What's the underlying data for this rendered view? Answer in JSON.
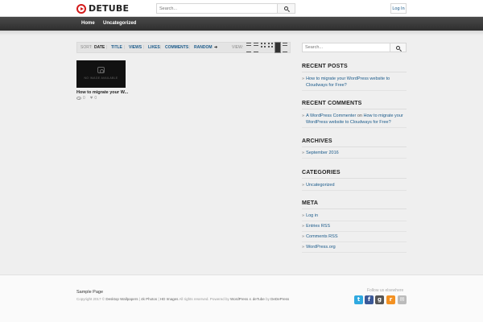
{
  "header": {
    "logo_text": "DETUBE",
    "search_placeholder": "Search...",
    "login_label": "Log In"
  },
  "nav": {
    "items": [
      {
        "label": "Home"
      },
      {
        "label": "Uncategorized"
      }
    ]
  },
  "sortbar": {
    "sort_label": "SORT:",
    "options": [
      "DATE",
      "TITLE",
      "VIEWS",
      "LIKES",
      "COMMENTS",
      "RANDOM"
    ],
    "active": "DATE",
    "random_arrow": "➔",
    "view_label": "VIEW:",
    "separator": "|"
  },
  "posts": [
    {
      "thumb_text": "NO IMAGE AVAILABLE",
      "title": "How to migrate your W...",
      "views": "0",
      "likes": "0"
    }
  ],
  "sidebar": {
    "search_placeholder": "Search...",
    "recent_posts": {
      "title": "RECENT POSTS",
      "items": [
        {
          "line1": "How to migrate your WordPress website to",
          "line2": "Cloudways for Free?"
        }
      ]
    },
    "recent_comments": {
      "title": "RECENT COMMENTS",
      "items": [
        {
          "author": "A WordPress Commenter",
          "on": "on",
          "line1": "How to migrate your",
          "line2": "WordPress website to Cloudways for Free?"
        }
      ]
    },
    "archives": {
      "title": "ARCHIVES",
      "items": [
        {
          "label": "September 2016"
        }
      ]
    },
    "categories": {
      "title": "CATEGORIES",
      "items": [
        {
          "label": "Uncategorized"
        }
      ]
    },
    "meta": {
      "title": "META",
      "items": [
        {
          "label": "Log in"
        },
        {
          "label": "Entries RSS"
        },
        {
          "label": "Comments RSS"
        },
        {
          "label": "WordPress.org"
        }
      ]
    },
    "arrow": "»"
  },
  "footer": {
    "sample_page": "Sample Page",
    "copyright_prefix": "Copyright 2017 ©",
    "link1": "Desktop Wallpapers",
    "sep": "|",
    "link2": "4k Photos",
    "link3": "HD Images",
    "rights": "All rights reserved. Powered by",
    "wp": "WordPress",
    "amp": "&",
    "theme": "deTube",
    "by": "by",
    "author": "DeDePress",
    "follow_label": "Follow us elsewhere",
    "social": [
      {
        "name": "twitter",
        "glyph": "t",
        "color": "#2fa9e0"
      },
      {
        "name": "facebook",
        "glyph": "f",
        "color": "#3b5998"
      },
      {
        "name": "google-plus",
        "glyph": "g",
        "color": "#555555"
      },
      {
        "name": "rss",
        "glyph": "r",
        "color": "#f39122"
      },
      {
        "name": "email",
        "glyph": "✉",
        "color": "#bbbbbb"
      }
    ]
  }
}
